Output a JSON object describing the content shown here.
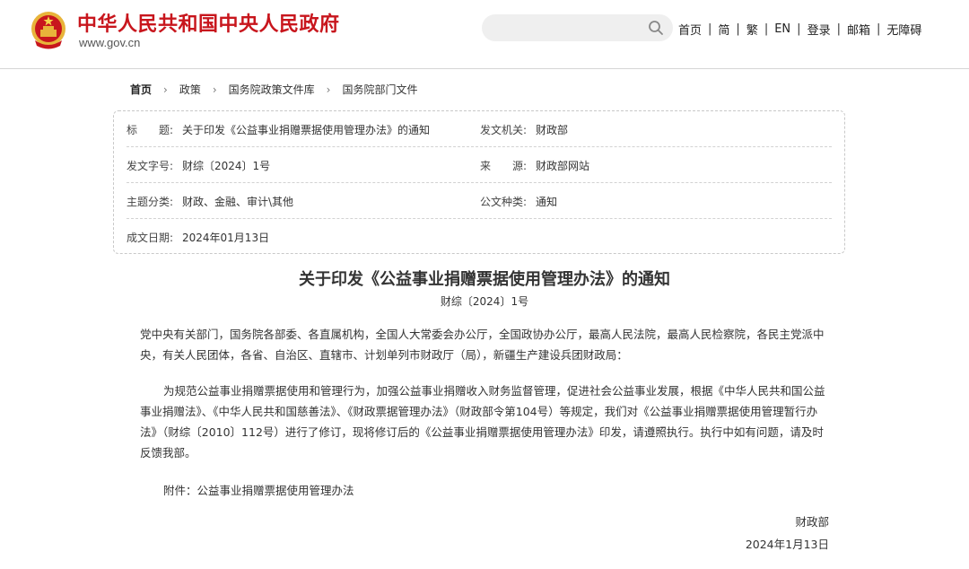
{
  "header": {
    "site_title": "中华人民共和国中央人民政府",
    "site_url": "www.gov.cn",
    "search_placeholder": "",
    "nav": [
      {
        "label": "首页"
      },
      {
        "label": "简"
      },
      {
        "label": "繁"
      },
      {
        "label": "EN"
      },
      {
        "label": "登录"
      },
      {
        "label": "邮箱"
      },
      {
        "label": "无障碍"
      }
    ],
    "nav_separator": "|"
  },
  "breadcrumb": {
    "items": [
      "首页",
      "政策",
      "国务院政策文件库",
      "国务院部门文件"
    ],
    "arrow": "›"
  },
  "info": {
    "title_label": "标　　题:",
    "title_value": "关于印发《公益事业捐赠票据使用管理办法》的通知",
    "issuer_label": "发文机关:",
    "issuer_value": "财政部",
    "doc_no_label": "发文字号:",
    "doc_no_value": "财综〔2024〕1号",
    "source_label": "来　　源:",
    "source_value": "财政部网站",
    "topic_label": "主题分类:",
    "topic_value": "财政、金融、审计\\其他",
    "doc_type_label": "公文种类:",
    "doc_type_value": "通知",
    "date_label": "成文日期:",
    "date_value": "2024年01月13日"
  },
  "document": {
    "title": "关于印发《公益事业捐赠票据使用管理办法》的通知",
    "number": "财综〔2024〕1号",
    "paragraph1": "党中央有关部门，国务院各部委、各直属机构，全国人大常委会办公厅，全国政协办公厅，最高人民法院，最高人民检察院，各民主党派中央，有关人民团体，各省、自治区、直辖市、计划单列市财政厅（局），新疆生产建设兵团财政局：",
    "paragraph2": "为规范公益事业捐赠票据使用和管理行为，加强公益事业捐赠收入财务监督管理，促进社会公益事业发展，根据《中华人民共和国公益事业捐赠法》、《中华人民共和国慈善法》、《财政票据管理办法》（财政部令第104号）等规定，我们对《公益事业捐赠票据使用管理暂行办法》（财综〔2010〕112号）进行了修订，现将修订后的《公益事业捐赠票据使用管理办法》印发，请遵照执行。执行中如有问题，请及时反馈我部。",
    "attachment": "附件：公益事业捐赠票据使用管理办法",
    "signature_org": "财政部",
    "signature_date": "2024年1月13日"
  },
  "colors": {
    "brand_red": "#c8161d",
    "emblem_gold": "#e8b43a"
  },
  "icons": {
    "emblem": "national-emblem-icon",
    "search": "search-icon"
  }
}
